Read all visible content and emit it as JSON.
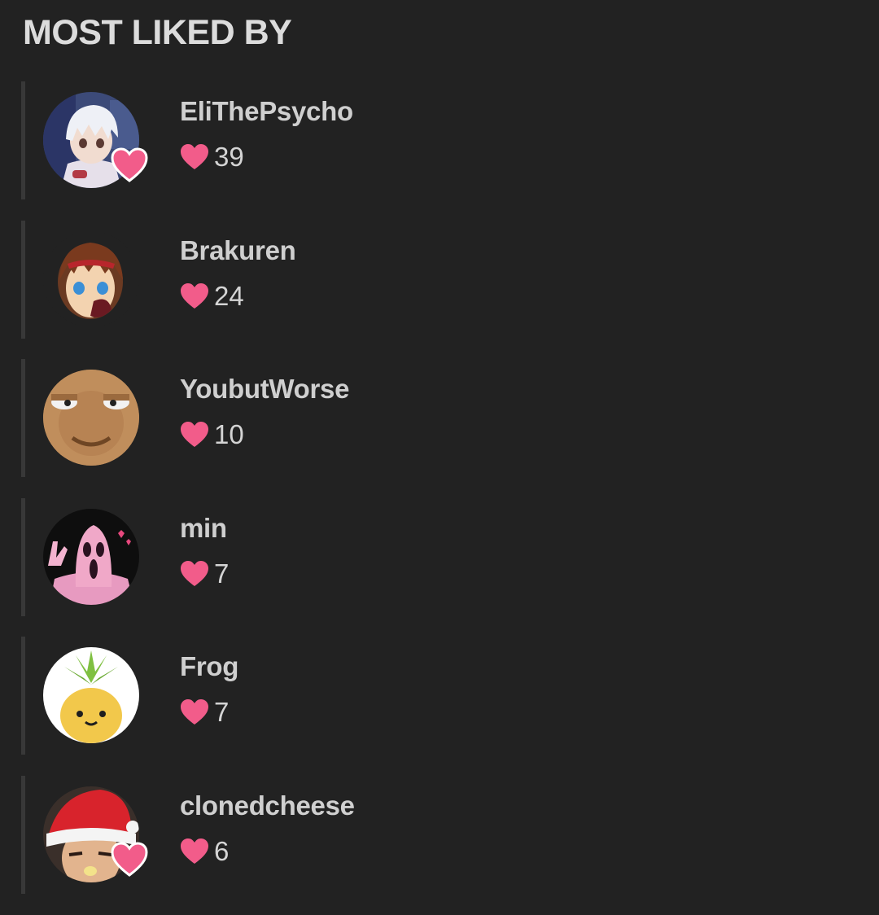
{
  "header": {
    "title": "MOST LIKED BY"
  },
  "colors": {
    "background": "#222222",
    "heart": "#f25c8a",
    "text": "#cfcfcf"
  },
  "users": [
    {
      "name": "EliThePsycho",
      "likes": "39",
      "avatar": "anime-white-hair-avatar",
      "badge": true
    },
    {
      "name": "Brakuren",
      "likes": "24",
      "avatar": "anime-brown-hair-avatar",
      "badge": false
    },
    {
      "name": "YoubutWorse",
      "likes": "10",
      "avatar": "bored-face-avatar",
      "badge": false
    },
    {
      "name": "min",
      "likes": "7",
      "avatar": "ghostface-pink-avatar",
      "badge": false
    },
    {
      "name": "Frog",
      "likes": "7",
      "avatar": "pineapple-avatar",
      "badge": false
    },
    {
      "name": "clonedcheese",
      "likes": "6",
      "avatar": "santa-hat-photo-avatar",
      "badge": true
    }
  ]
}
